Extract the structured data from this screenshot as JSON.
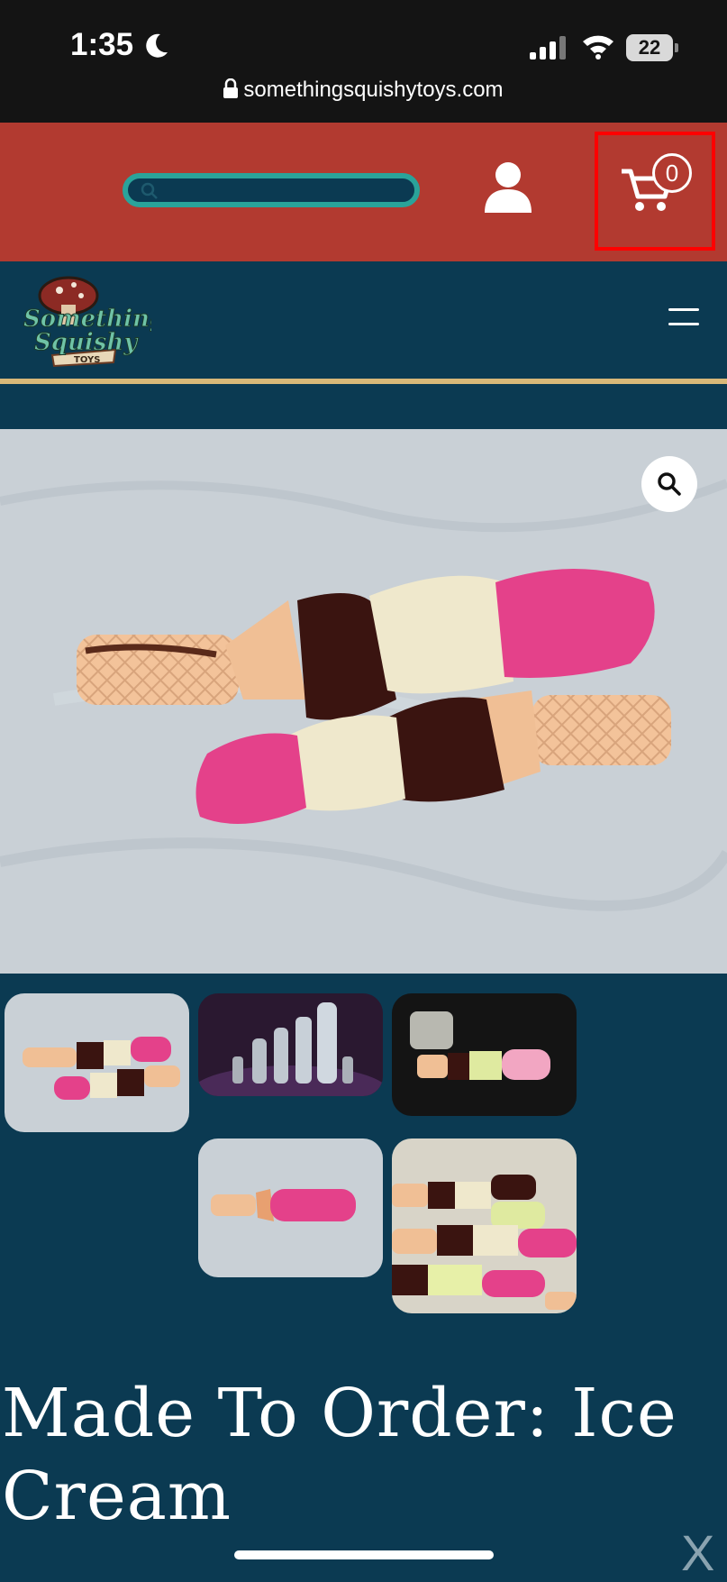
{
  "status": {
    "time": "1:35",
    "battery": "22",
    "url": "somethingsquishytoys.com"
  },
  "header": {
    "search": {
      "placeholder": ""
    },
    "cart": {
      "count": "0"
    }
  },
  "brand": {
    "logo_line1": "Something",
    "logo_line2": "Squishy",
    "logo_line3": "TOYS"
  },
  "gallery": {
    "main_image_alt": "Two ice cream cone toys with pink, cream and chocolate layers on a grey cloth",
    "thumbnails": [
      "ice-cream-pair",
      "silver-stacked-toys",
      "pastel-on-black",
      "pink-cone-single",
      "many-cones"
    ]
  },
  "product": {
    "title": "Made To Order: Ice Cream"
  },
  "overlay": {
    "close": "X"
  },
  "colors": {
    "header_red": "#b23a30",
    "navy": "#0b3a52",
    "teal": "#2aa39a",
    "gold": "#d8b878",
    "cart_highlight": "#ff0000"
  }
}
